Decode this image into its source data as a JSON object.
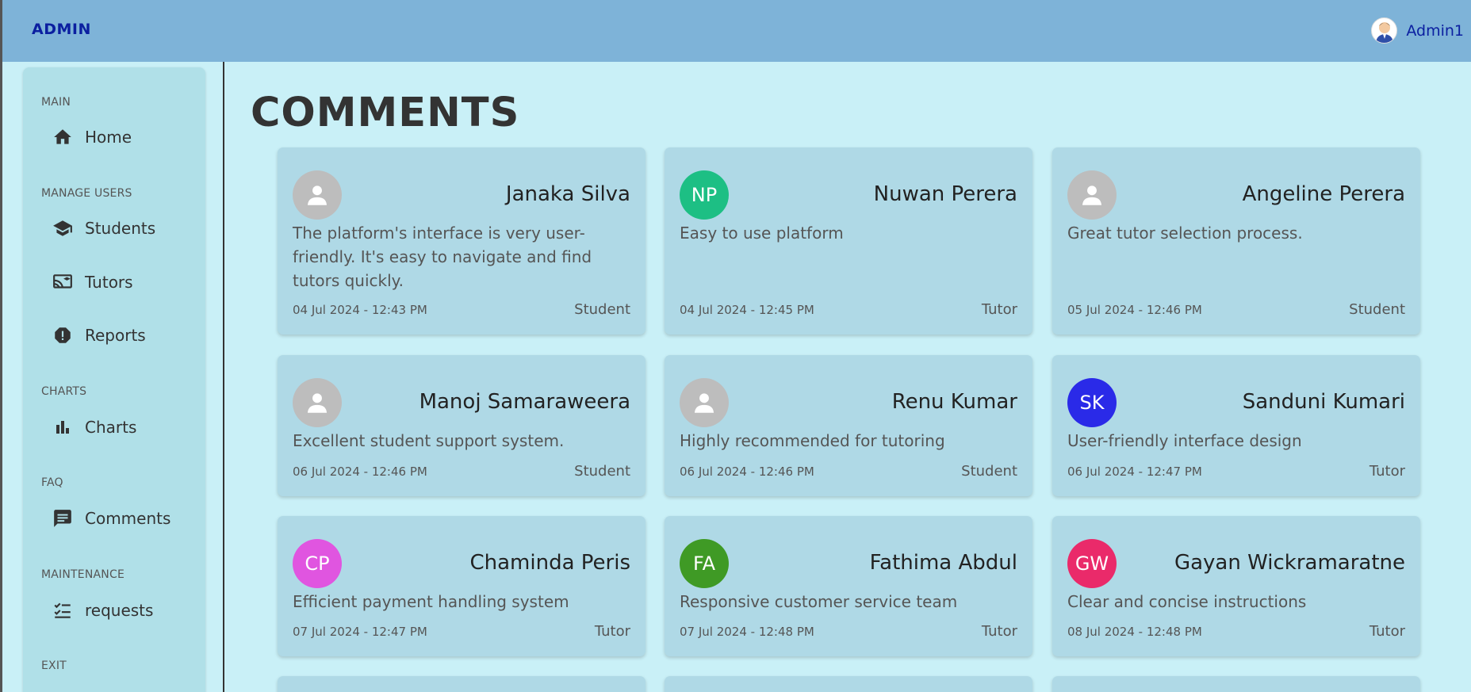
{
  "header": {
    "brand": "ADMIN",
    "user_name": "Admin1"
  },
  "sidebar": {
    "sections": [
      {
        "label": "MAIN",
        "items": [
          {
            "label": "Home",
            "icon": "home-icon"
          }
        ]
      },
      {
        "label": "MANAGE USERS",
        "items": [
          {
            "label": "Students",
            "icon": "graduation-cap-icon"
          },
          {
            "label": "Tutors",
            "icon": "tutor-board-icon"
          },
          {
            "label": "Reports",
            "icon": "report-alert-icon"
          }
        ]
      },
      {
        "label": "CHARTS",
        "items": [
          {
            "label": "Charts",
            "icon": "bar-chart-icon"
          }
        ]
      },
      {
        "label": "FAQ",
        "items": [
          {
            "label": "Comments",
            "icon": "comment-icon"
          }
        ]
      },
      {
        "label": "MAINTENANCE",
        "items": [
          {
            "label": "requests",
            "icon": "checklist-icon"
          }
        ]
      },
      {
        "label": "EXIT",
        "items": []
      }
    ]
  },
  "page": {
    "title": "COMMENTS"
  },
  "comments": [
    {
      "name": "Janaka Silva",
      "initials": "",
      "avatar_color": "#bdbdbd",
      "text": "The platform's interface is very user-friendly. It's easy to navigate and find tutors quickly.",
      "date": "04 Jul 2024 - 12:43 PM",
      "role": "Student"
    },
    {
      "name": "Nuwan Perera",
      "initials": "NP",
      "avatar_color": "#1dbf84",
      "text": "Easy to use platform",
      "date": "04 Jul 2024 - 12:45 PM",
      "role": "Tutor"
    },
    {
      "name": "Angeline Perera",
      "initials": "",
      "avatar_color": "#bdbdbd",
      "text": "Great tutor selection process.",
      "date": "05 Jul 2024 - 12:46 PM",
      "role": "Student"
    },
    {
      "name": "Manoj Samaraweera",
      "initials": "",
      "avatar_color": "#bdbdbd",
      "text": "Excellent student support system.",
      "date": "06 Jul 2024 - 12:46 PM",
      "role": "Student"
    },
    {
      "name": "Renu Kumar",
      "initials": "",
      "avatar_color": "#bdbdbd",
      "text": "Highly recommended for tutoring",
      "date": "06 Jul 2024 - 12:46 PM",
      "role": "Student"
    },
    {
      "name": "Sanduni Kumari",
      "initials": "SK",
      "avatar_color": "#2a2ae8",
      "text": "User-friendly interface design",
      "date": "06 Jul 2024 - 12:47 PM",
      "role": "Tutor"
    },
    {
      "name": "Chaminda Peris",
      "initials": "CP",
      "avatar_color": "#e055e0",
      "text": "Efficient payment handling system",
      "date": "07 Jul 2024 - 12:47 PM",
      "role": "Tutor"
    },
    {
      "name": "Fathima Abdul",
      "initials": "FA",
      "avatar_color": "#3f9a25",
      "text": "Responsive customer service team",
      "date": "07 Jul 2024 - 12:48 PM",
      "role": "Tutor"
    },
    {
      "name": "Gayan Wickramaratne",
      "initials": "GW",
      "avatar_color": "#ea2a6a",
      "text": "Clear and concise instructions",
      "date": "08 Jul 2024 - 12:48 PM",
      "role": "Tutor"
    }
  ]
}
